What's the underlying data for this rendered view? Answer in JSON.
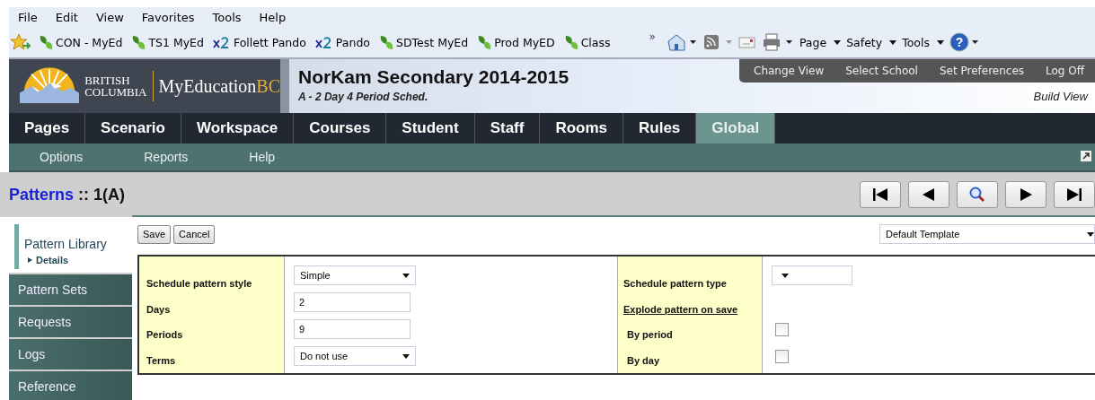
{
  "menu_bar": [
    "File",
    "Edit",
    "View",
    "Favorites",
    "Tools",
    "Help"
  ],
  "favorites": [
    {
      "label": "CON - MyEd",
      "kind": "leaf"
    },
    {
      "label": "TS1 MyEd",
      "kind": "leaf"
    },
    {
      "label": "Follett Pando",
      "kind": "x2"
    },
    {
      "label": "Pando",
      "kind": "x2"
    },
    {
      "label": "SDTest MyEd",
      "kind": "leaf"
    },
    {
      "label": "Prod MyED",
      "kind": "leaf"
    },
    {
      "label": "Class",
      "kind": "leaf"
    }
  ],
  "browser_tools": {
    "overflow": "»",
    "menus": [
      "Page",
      "Safety",
      "Tools"
    ],
    "help": "?"
  },
  "header": {
    "logo_line1": "BRITISH",
    "logo_line2": "COLUMBIA",
    "logo_brand": "MyEducation",
    "logo_brand_suffix": "BC",
    "school": "NorKam Secondary 2014-2015",
    "schedule": "A - 2 Day 4 Period Sched.",
    "links": [
      "Change View",
      "Select School",
      "Set Preferences",
      "Log Off"
    ],
    "view": "Build View"
  },
  "tabs": [
    {
      "label": "Pages",
      "selected": false
    },
    {
      "label": "Scenario",
      "selected": false
    },
    {
      "label": "Workspace",
      "selected": false
    },
    {
      "label": "Courses",
      "selected": false
    },
    {
      "label": "Student",
      "selected": false
    },
    {
      "label": "Staff",
      "selected": false
    },
    {
      "label": "Rooms",
      "selected": false
    },
    {
      "label": "Rules",
      "selected": false
    },
    {
      "label": "Global",
      "selected": true
    }
  ],
  "subnav": [
    "Options",
    "Reports",
    "Help"
  ],
  "page_title": {
    "section": "Patterns",
    "separator": "::",
    "record": "1(A)"
  },
  "sidebar": {
    "items": [
      {
        "label": "Pattern Library",
        "selected": true,
        "children": [
          {
            "label": "Details"
          }
        ]
      },
      {
        "label": "Pattern Sets",
        "selected": false
      },
      {
        "label": "Requests",
        "selected": false
      },
      {
        "label": "Logs",
        "selected": false
      },
      {
        "label": "Reference",
        "selected": false
      }
    ]
  },
  "buttons": [
    "Save",
    "Cancel"
  ],
  "template": "Default Template",
  "form_left": [
    {
      "label": "Schedule pattern style",
      "kind": "select",
      "value": "Simple"
    },
    {
      "label": "Days",
      "kind": "text",
      "value": "2"
    },
    {
      "label": "Periods",
      "kind": "text",
      "value": "9"
    },
    {
      "label": "Terms",
      "kind": "select",
      "value": "Do not use"
    }
  ],
  "form_right": [
    {
      "label": "Schedule pattern type",
      "kind": "select"
    },
    {
      "label": "Explode pattern on save",
      "kind": "heading"
    },
    {
      "label": "By period",
      "kind": "checkbox",
      "checked": false
    },
    {
      "label": "By day",
      "kind": "checkbox",
      "checked": false
    }
  ]
}
